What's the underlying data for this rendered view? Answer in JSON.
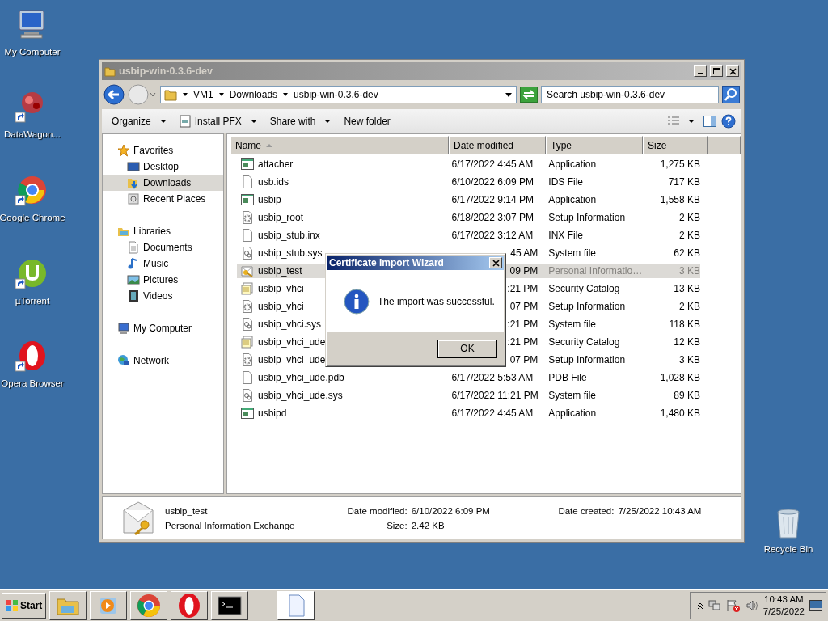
{
  "desktop_icons": [
    {
      "label": "My Computer",
      "kind": "computer",
      "shortcut": false
    },
    {
      "label": "DataWagon...",
      "kind": "wagon",
      "shortcut": true
    },
    {
      "label": "Google Chrome",
      "kind": "chrome",
      "shortcut": true
    },
    {
      "label": "µTorrent",
      "kind": "torrent",
      "shortcut": true
    },
    {
      "label": "Opera Browser",
      "kind": "opera",
      "shortcut": true
    },
    {
      "label": "Recycle Bin",
      "kind": "bin",
      "shortcut": false
    }
  ],
  "explorer": {
    "title": "usbip-win-0.3.6-dev",
    "breadcrumb": [
      "VM1",
      "Downloads",
      "usbip-win-0.3.6-dev"
    ],
    "search": {
      "placeholder": "Search usbip-win-0.3.6-dev"
    },
    "toolbar": [
      {
        "label": "Organize",
        "kind": "menu"
      },
      {
        "label": "Install PFX",
        "kind": "install"
      },
      {
        "label": "Share with",
        "kind": "menu"
      },
      {
        "label": "New folder",
        "kind": "plain"
      }
    ],
    "nav": [
      {
        "label": "Favorites",
        "kind": "star",
        "children": [
          {
            "label": "Desktop",
            "kind": "desktop",
            "selected": false
          },
          {
            "label": "Downloads",
            "kind": "downloads",
            "selected": true
          },
          {
            "label": "Recent Places",
            "kind": "recent",
            "selected": false
          }
        ]
      },
      {
        "label": "Libraries",
        "kind": "library",
        "children": [
          {
            "label": "Documents",
            "kind": "documents",
            "selected": false
          },
          {
            "label": "Music",
            "kind": "music",
            "selected": false
          },
          {
            "label": "Pictures",
            "kind": "pictures",
            "selected": false
          },
          {
            "label": "Videos",
            "kind": "videos",
            "selected": false
          }
        ]
      },
      {
        "label": "My Computer",
        "kind": "computer"
      },
      {
        "label": "Network",
        "kind": "network"
      }
    ],
    "columns": [
      {
        "label": "Name",
        "sorted": true
      },
      {
        "label": "Date modified",
        "sorted": false
      },
      {
        "label": "Type",
        "sorted": false
      },
      {
        "label": "Size",
        "sorted": false
      }
    ],
    "files": [
      {
        "name": "attacher",
        "kind": "app",
        "date": "6/17/2022 4:45 AM",
        "covered": false,
        "type": "Application",
        "size": "1,275 KB",
        "selected": false
      },
      {
        "name": "usb.ids",
        "kind": "blank",
        "date": "6/10/2022 6:09 PM",
        "covered": false,
        "type": "IDS File",
        "size": "717 KB",
        "selected": false
      },
      {
        "name": "usbip",
        "kind": "app",
        "date": "6/17/2022 9:14 PM",
        "covered": false,
        "type": "Application",
        "size": "1,558 KB",
        "selected": false
      },
      {
        "name": "usbip_root",
        "kind": "setup",
        "date": "6/18/2022 3:07 PM",
        "covered": false,
        "type": "Setup Information",
        "size": "2 KB",
        "selected": false
      },
      {
        "name": "usbip_stub.inx",
        "kind": "blank",
        "date": "6/17/2022 3:12 AM",
        "covered": false,
        "type": "INX File",
        "size": "2 KB",
        "selected": false
      },
      {
        "name": "usbip_stub.sys",
        "kind": "sys",
        "date": "45 AM",
        "covered": true,
        "type": "System file",
        "size": "62 KB",
        "selected": false
      },
      {
        "name": "usbip_test",
        "kind": "cert",
        "date": "09 PM",
        "covered": true,
        "type": "Personal Informatio…",
        "size": "3 KB",
        "selected": true
      },
      {
        "name": "usbip_vhci",
        "kind": "catalog",
        "date": ":21 PM",
        "covered": true,
        "type": "Security Catalog",
        "size": "13 KB",
        "selected": false
      },
      {
        "name": "usbip_vhci",
        "kind": "setup",
        "date": "07 PM",
        "covered": true,
        "type": "Setup Information",
        "size": "2 KB",
        "selected": false
      },
      {
        "name": "usbip_vhci.sys",
        "kind": "sys",
        "date": ":21 PM",
        "covered": true,
        "type": "System file",
        "size": "118 KB",
        "selected": false
      },
      {
        "name": "usbip_vhci_ude",
        "kind": "catalog",
        "date": ":21 PM",
        "covered": true,
        "type": "Security Catalog",
        "size": "12 KB",
        "selected": false
      },
      {
        "name": "usbip_vhci_ude",
        "kind": "setup",
        "date": "07 PM",
        "covered": true,
        "type": "Setup Information",
        "size": "3 KB",
        "selected": false
      },
      {
        "name": "usbip_vhci_ude.pdb",
        "kind": "blank",
        "date": "6/17/2022 5:53 AM",
        "covered": false,
        "type": "PDB File",
        "size": "1,028 KB",
        "selected": false
      },
      {
        "name": "usbip_vhci_ude.sys",
        "kind": "sys",
        "date": "6/17/2022 11:21 PM",
        "covered": false,
        "type": "System file",
        "size": "89 KB",
        "selected": false
      },
      {
        "name": "usbipd",
        "kind": "app",
        "date": "6/17/2022 4:45 AM",
        "covered": false,
        "type": "Application",
        "size": "1,480 KB",
        "selected": false
      }
    ],
    "details": {
      "name": "usbip_test",
      "type": "Personal Information Exchange",
      "fields": [
        {
          "label": "Date modified:",
          "value": "6/10/2022 6:09 PM"
        },
        {
          "label": "Date created:",
          "value": "7/25/2022 10:43 AM"
        },
        {
          "label": "Size:",
          "value": "2.42 KB"
        }
      ]
    }
  },
  "dialog": {
    "title": "Certificate Import Wizard",
    "message": "The import was successful.",
    "button": "OK"
  },
  "taskbar": {
    "start": "Start",
    "apps": [
      {
        "kind": "explorer"
      },
      {
        "kind": "media"
      },
      {
        "kind": "chrome"
      },
      {
        "kind": "opera"
      },
      {
        "kind": "console"
      },
      {
        "kind": "document"
      }
    ],
    "clock": {
      "time": "10:43 AM",
      "date": "7/25/2022"
    }
  }
}
